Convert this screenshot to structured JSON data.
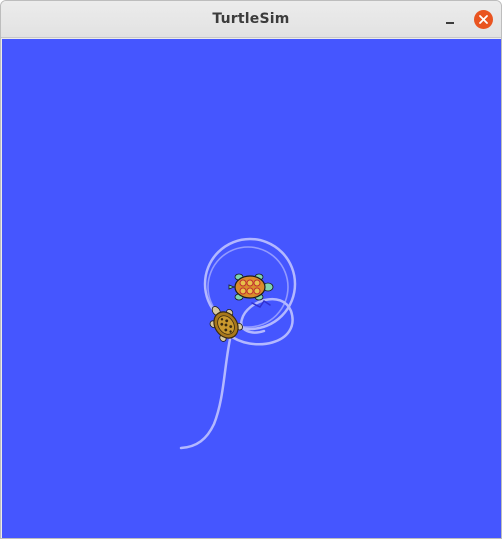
{
  "window": {
    "title": "TurtleSim"
  },
  "controls": {
    "minimize_icon": "minimize-icon",
    "close_icon": "close-icon"
  },
  "colors": {
    "background": "#4556ff",
    "pen": "#b3b8ff",
    "close_button": "#e95420"
  },
  "canvas": {
    "turtles": [
      "turtle1",
      "turtle2"
    ]
  }
}
